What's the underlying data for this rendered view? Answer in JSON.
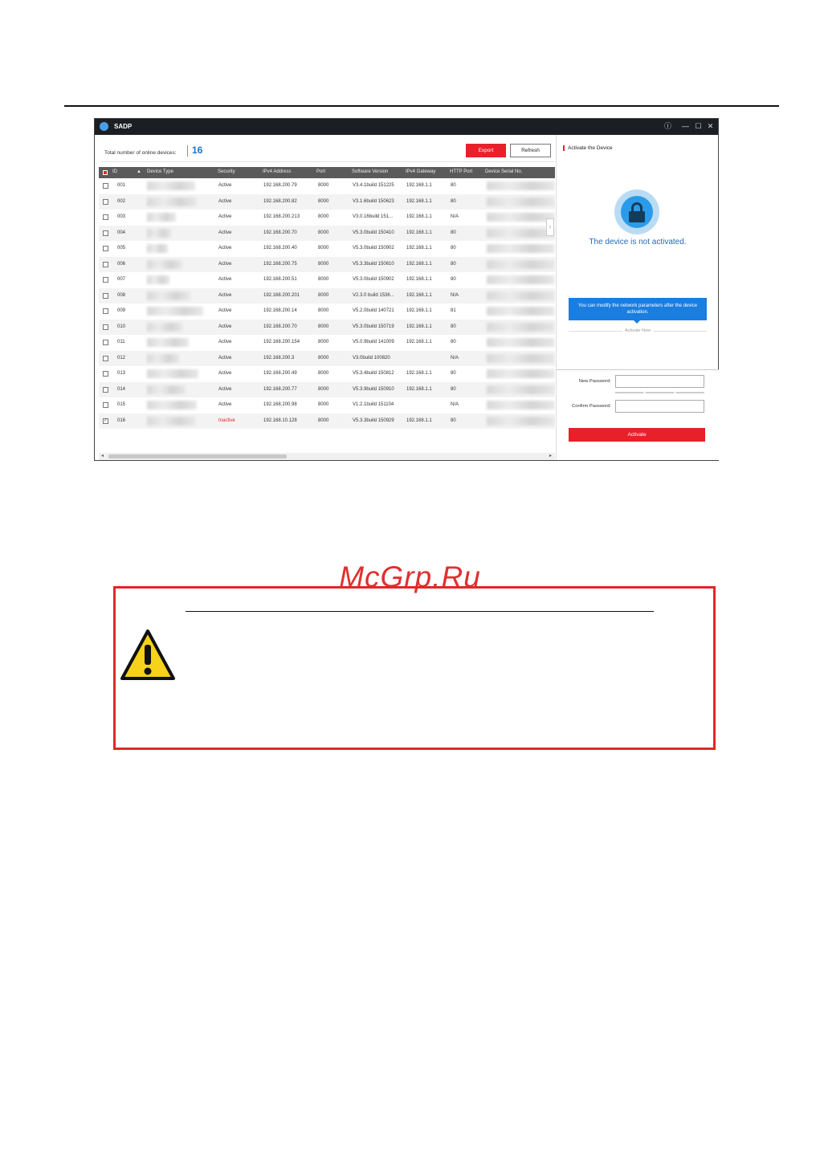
{
  "window": {
    "app_title": "SADP",
    "controls": [
      "ⓘ",
      "—",
      "☐",
      "✕"
    ]
  },
  "summary": {
    "label": "Total number of online devices:",
    "count": "16",
    "export_label": "Export",
    "refresh_label": "Refresh"
  },
  "columns": [
    "ID",
    "Device Type",
    "Security",
    "IPv4 Address",
    "Port",
    "Software Version",
    "IPv4 Gateway",
    "HTTP Port",
    "Device Serial No."
  ],
  "rows": [
    {
      "id": "001",
      "security": "Active",
      "ip": "192.168.200.79",
      "port": "8000",
      "sw": "V3.4.1build 151225",
      "gw": "192.168.1.1",
      "http": "80",
      "checked": false
    },
    {
      "id": "002",
      "security": "Active",
      "ip": "192.168.200.82",
      "port": "8000",
      "sw": "V3.1.6build 150623",
      "gw": "192.168.1.1",
      "http": "80",
      "checked": false
    },
    {
      "id": "003",
      "security": "Active",
      "ip": "192.168.200.213",
      "port": "8000",
      "sw": "V3.0.16build 151...",
      "gw": "192.168.1.1",
      "http": "N/A",
      "checked": false
    },
    {
      "id": "004",
      "security": "Active",
      "ip": "192.168.200.70",
      "port": "8000",
      "sw": "V5.3.0build 150410",
      "gw": "192.168.1.1",
      "http": "80",
      "checked": false
    },
    {
      "id": "005",
      "security": "Active",
      "ip": "192.168.200.40",
      "port": "8000",
      "sw": "V5.3.0build 150902",
      "gw": "192.168.1.1",
      "http": "80",
      "checked": false
    },
    {
      "id": "006",
      "security": "Active",
      "ip": "192.168.200.75",
      "port": "8000",
      "sw": "V5.3.3build 150610",
      "gw": "192.168.1.1",
      "http": "80",
      "checked": false
    },
    {
      "id": "007",
      "security": "Active",
      "ip": "192.168.200.51",
      "port": "8000",
      "sw": "V5.3.0build 150902",
      "gw": "192.168.1.1",
      "http": "80",
      "checked": false
    },
    {
      "id": "008",
      "security": "Active",
      "ip": "192.168.200.201",
      "port": "8000",
      "sw": "V2.3.0 build 1536...",
      "gw": "192.168.1.1",
      "http": "N/A",
      "checked": false
    },
    {
      "id": "009",
      "security": "Active",
      "ip": "192.168.200.14",
      "port": "8000",
      "sw": "V5.2.0build 140721",
      "gw": "192.168.1.1",
      "http": "81",
      "checked": false
    },
    {
      "id": "010",
      "security": "Active",
      "ip": "192.168.200.70",
      "port": "8000",
      "sw": "V5.3.0build 150719",
      "gw": "192.168.1.1",
      "http": "80",
      "checked": false
    },
    {
      "id": "011",
      "security": "Active",
      "ip": "192.168.200.154",
      "port": "8000",
      "sw": "V5.0.9build 141009",
      "gw": "192.168.1.1",
      "http": "80",
      "checked": false
    },
    {
      "id": "012",
      "security": "Active",
      "ip": "192.168.200.3",
      "port": "8000",
      "sw": "V3.0build 100820",
      "gw": "",
      "http": "N/A",
      "checked": false
    },
    {
      "id": "013",
      "security": "Active",
      "ip": "192.168.200.49",
      "port": "8000",
      "sw": "V5.3.4build 150812",
      "gw": "192.168.1.1",
      "http": "80",
      "checked": false
    },
    {
      "id": "014",
      "security": "Active",
      "ip": "192.168.200.77",
      "port": "8000",
      "sw": "V5.3.9build 150910",
      "gw": "192.168.1.1",
      "http": "80",
      "checked": false
    },
    {
      "id": "015",
      "security": "Active",
      "ip": "192.168.200.98",
      "port": "8000",
      "sw": "V1.2.1build 151104",
      "gw": "",
      "http": "N/A",
      "checked": false
    },
    {
      "id": "016",
      "security": "Inactive",
      "ip": "192.168.10.128",
      "port": "8000",
      "sw": "V5.3.3build 150929",
      "gw": "192.168.1.1",
      "http": "80",
      "checked": true
    }
  ],
  "activation": {
    "title": "Activate the Device",
    "status": "The device is not activated.",
    "tip": "You can modify the network parameters after the device activation.",
    "activate_now": "Activate Now",
    "new_password_label": "New Password:",
    "confirm_password_label": "Confirm Password:",
    "activate_label": "Activate"
  },
  "watermark": "McGrp.Ru",
  "warning": {
    "icon": "warning-triangle-icon"
  }
}
